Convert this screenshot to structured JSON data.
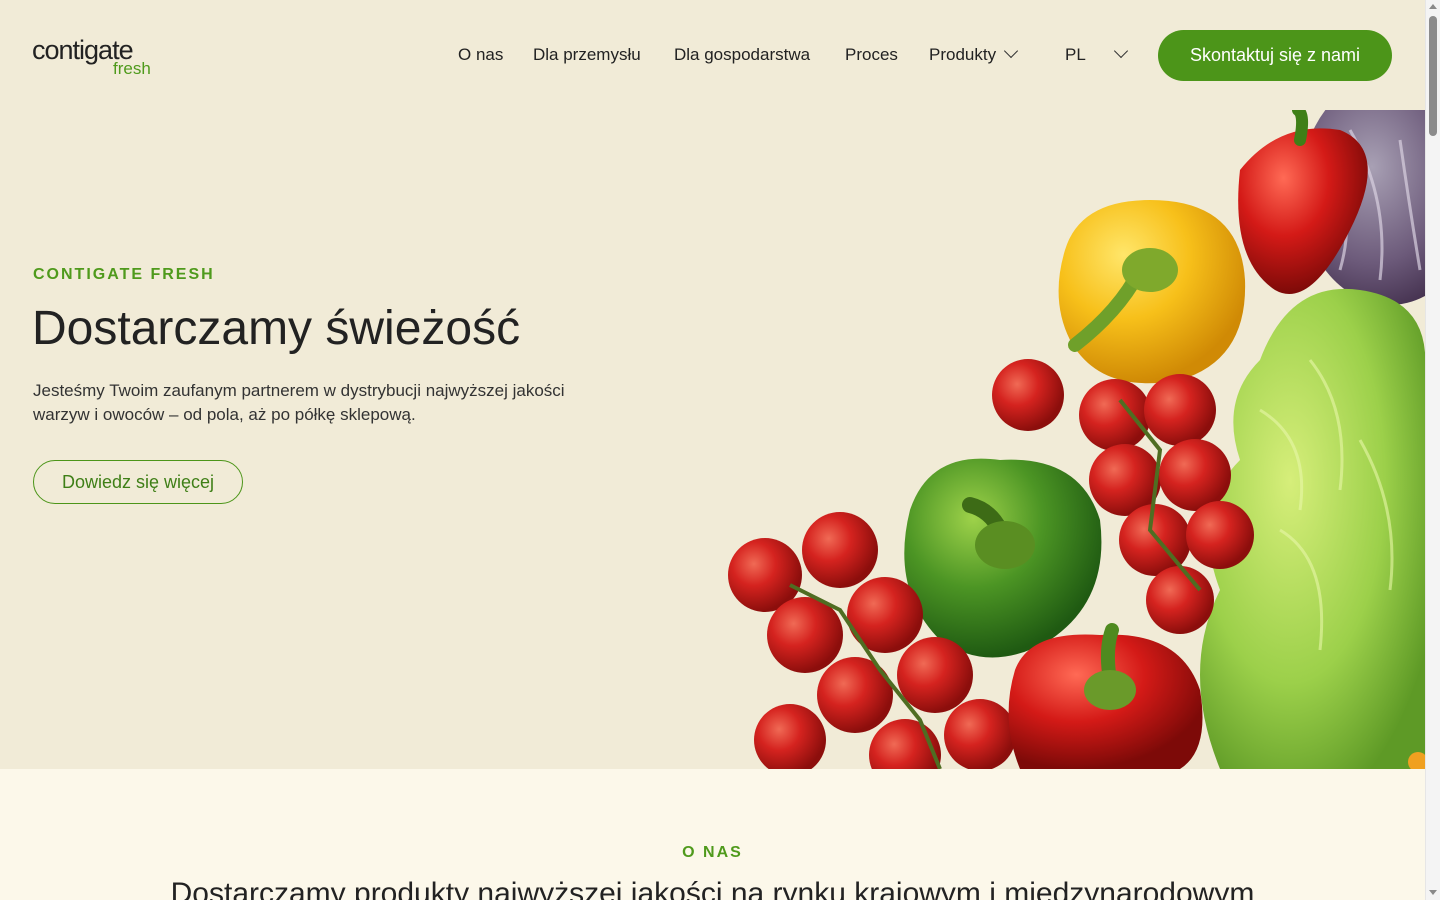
{
  "brand": {
    "name": "contigate",
    "sub": "fresh"
  },
  "nav": {
    "items": [
      "O nas",
      "Dla przemysłu",
      "Dla gospodarstwa",
      "Proces",
      "Produkty"
    ],
    "language": "PL",
    "cta_label": "Skontaktuj się z nami"
  },
  "hero": {
    "eyebrow": "CONTIGATE FRESH",
    "title": "Dostarczamy świeżość",
    "text": "Jesteśmy Twoim zaufanym partnerem w dystrybucji najwyższej jakości warzyw i owoców – od pola, aż po półkę sklepową.",
    "button_label": "Dowiedz się więcej"
  },
  "about": {
    "eyebrow": "O NAS",
    "title": "Dostarczamy produkty najwyższej jakości na rynku krajowym i międzynarodowym"
  },
  "colors": {
    "accent": "#4c9519",
    "background": "#f1ebd7",
    "section_bg": "#fcf8ea"
  }
}
